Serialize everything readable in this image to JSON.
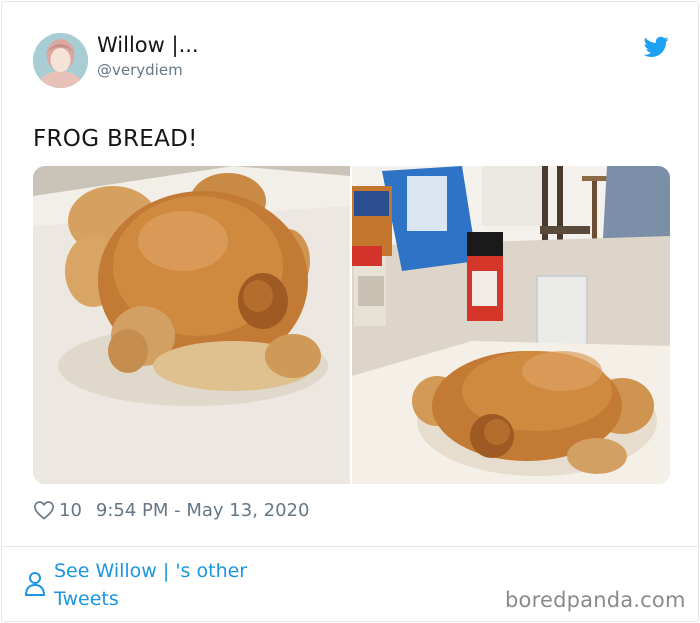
{
  "tweet": {
    "author_name": "Willow |...",
    "author_handle": "@verydiem",
    "text": "FROG BREAD!",
    "like_count": "10",
    "timestamp": "9:54 PM - May 13, 2020"
  },
  "footer": {
    "see_more_label": "See Willow |  's other Tweets",
    "watermark": "boredpanda.com"
  },
  "icons": {
    "avatar": "avatar",
    "brand": "twitter-bird-icon",
    "like": "heart-icon",
    "profile": "person-icon"
  },
  "colors": {
    "twitter_blue": "#1da1f2",
    "link_blue": "#1b95e0",
    "muted_text": "#657786"
  }
}
